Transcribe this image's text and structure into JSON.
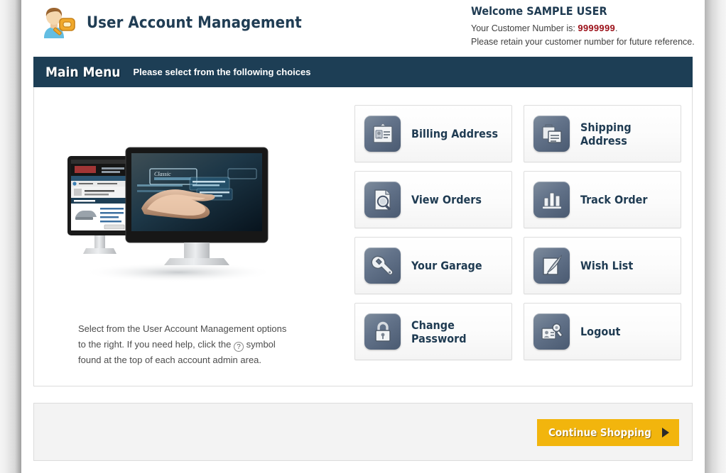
{
  "header": {
    "logo_icon": "user-key-icon",
    "title": "User Account Management",
    "welcome_title": "Welcome SAMPLE USER",
    "customer_label": "Your Customer Number is:",
    "customer_number": "9999999",
    "customer_period": ".",
    "retain_note": "Please retain your customer number for future reference."
  },
  "menubar": {
    "title": "Main Menu",
    "subtitle": "Please select from the following choices"
  },
  "content": {
    "illustration": "dual-monitor-image",
    "intro_part1": "Select from the User Account Management options to the right. If you need help, click the",
    "intro_help_symbol": "?",
    "intro_part2": "symbol found at the top of each account admin area."
  },
  "menu_tiles": [
    {
      "id": "billing-address",
      "label": "Billing Address",
      "icon": "id-card-icon"
    },
    {
      "id": "shipping-address",
      "label": "Shipping Address",
      "icon": "package-box-icon"
    },
    {
      "id": "view-orders",
      "label": "View Orders",
      "icon": "document-search-icon"
    },
    {
      "id": "track-order",
      "label": "Track Order",
      "icon": "bar-chart-icon"
    },
    {
      "id": "your-garage",
      "label": "Your Garage",
      "icon": "wrench-icon"
    },
    {
      "id": "wish-list",
      "label": "Wish List",
      "icon": "note-pen-icon"
    },
    {
      "id": "change-password",
      "label": "Change Password",
      "icon": "padlock-icon"
    },
    {
      "id": "logout",
      "label": "Logout",
      "icon": "id-card-key-icon"
    }
  ],
  "footer": {
    "cta_label": "Continue Shopping",
    "cta_arrow": "play-triangle-icon"
  },
  "colors": {
    "header_bar": "#1d3e55",
    "label_navy": "#1f3b52",
    "customer_red": "#9b0f18",
    "cta_amber": "#f2b50d",
    "tile_icon_blue_gray": "#5a6b80",
    "panel_border": "#dcdcdc",
    "footer_fill": "#f3f3f3"
  }
}
